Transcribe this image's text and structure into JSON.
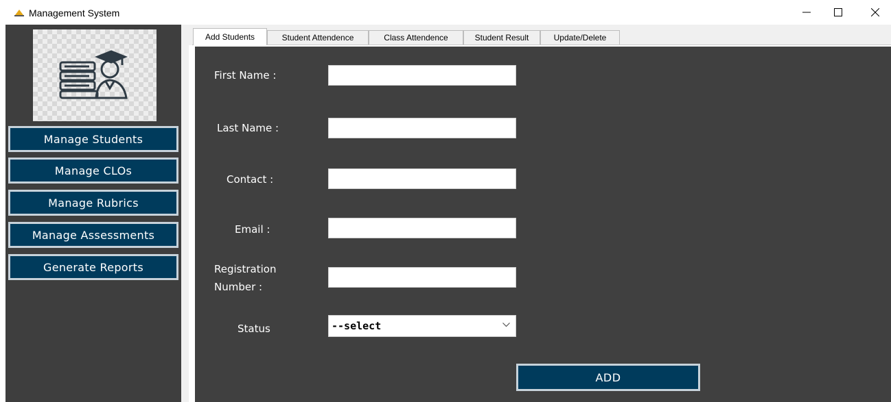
{
  "window": {
    "title": "Management System"
  },
  "sidebar": {
    "logo_icon": "student-books-graduate-icon",
    "items": [
      {
        "label": "Manage Students"
      },
      {
        "label": "Manage CLOs"
      },
      {
        "label": "Manage Rubrics"
      },
      {
        "label": "Manage Assessments"
      },
      {
        "label": "Generate Reports"
      }
    ]
  },
  "tabs": [
    {
      "label": "Add Students",
      "active": true
    },
    {
      "label": "Student Attendence",
      "active": false
    },
    {
      "label": "Class Attendence",
      "active": false
    },
    {
      "label": "Student Result",
      "active": false
    },
    {
      "label": "Update/Delete",
      "active": false
    }
  ],
  "form": {
    "first_name_label": "First Name :",
    "first_name_value": "",
    "last_name_label": "Last Name :",
    "last_name_value": "",
    "contact_label": "Contact :",
    "contact_value": "",
    "email_label": "Email :",
    "email_value": "",
    "registration_label_line1": "Registration",
    "registration_label_line2": "Number :",
    "registration_value": "",
    "status_label": "Status",
    "status_selected": "--select",
    "add_button": "ADD"
  },
  "colors": {
    "sidebar_bg": "#3e3e3e",
    "panel_bg": "#404040",
    "button_bg": "#003b5c",
    "button_border": "#c7d2da"
  }
}
